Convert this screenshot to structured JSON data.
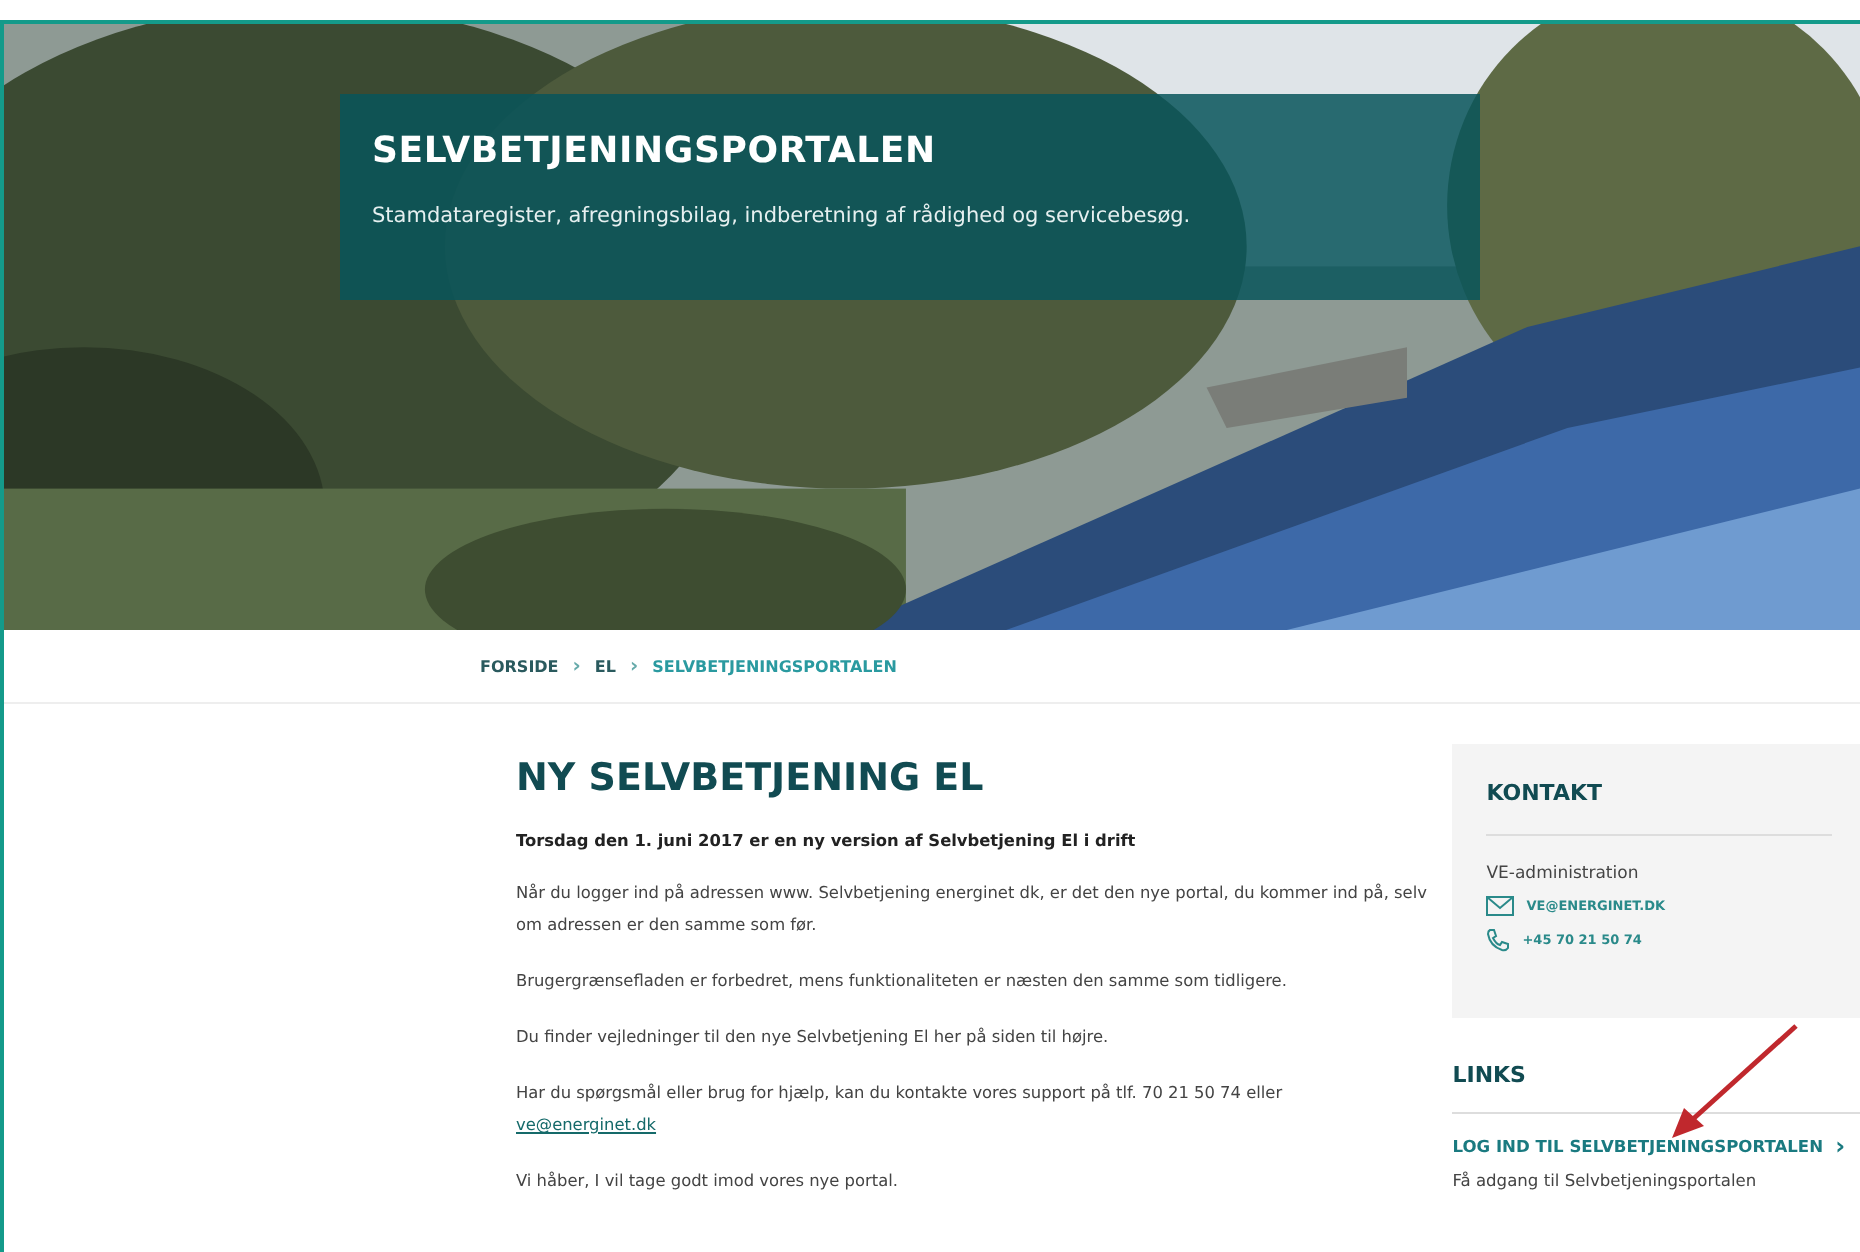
{
  "hero": {
    "title": "SELVBETJENINGSPORTALEN",
    "subtitle": "Stamdataregister, afregningsbilag, indberetning af rådighed og servicebesøg."
  },
  "breadcrumb": [
    {
      "label": "FORSIDE",
      "selected": false
    },
    {
      "label": "EL",
      "selected": false
    },
    {
      "label": "SELVBETJENINGSPORTALEN",
      "selected": true
    }
  ],
  "breadcrumb_separator": "›",
  "article": {
    "heading": "NY SELVBETJENING EL",
    "lead": "Torsdag den 1. juni 2017 er en ny version af Selvbetjening El i drift",
    "paragraphs": [
      "Når du logger ind på adressen www. Selvbetjening energinet dk, er det den nye portal, du kommer ind på, selv om adressen er den samme som før.",
      "Brugergrænsefladen er forbedret, mens funktionaliteten er næsten den samme som tidligere.",
      "Du finder vejledninger til den nye Selvbetjening El her på siden til højre."
    ],
    "support_text": "Har du spørgsmål eller brug for hjælp, kan du kontakte vores support på tlf. 70 21 50 74 eller",
    "support_link": "ve@energinet.dk",
    "closing": "Vi håber, I vil tage godt imod vores nye portal."
  },
  "contact": {
    "title": "KONTAKT",
    "name": "VE-administration",
    "email": "VE@ENERGINET.DK",
    "phone": "+45 70 21 50 74"
  },
  "links": {
    "title": "LINKS",
    "items": [
      {
        "label": "LOG IND TIL SELVBETJENINGSPORTALEN",
        "arrow": "›",
        "description": "Få adgang til Selvbetjeningsportalen"
      }
    ]
  }
}
